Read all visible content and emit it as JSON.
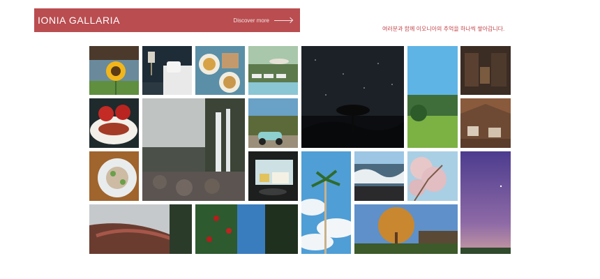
{
  "header": {
    "brand": "IONIA GALLARIA",
    "discover_label": "Discover more"
  },
  "tagline": "여러분과 함께 이오니아의 추억을 하나씩 쌓아갑니다.",
  "gallery": {
    "photos": [
      {
        "subject": "sunflower-photo"
      },
      {
        "subject": "hotel-bedroom-photo"
      },
      {
        "subject": "breakfast-table-photo"
      },
      {
        "subject": "poolside-loungers-photo"
      },
      {
        "subject": "night-sky-tree-photo"
      },
      {
        "subject": "green-field-sky-photo"
      },
      {
        "subject": "library-cafe-photo"
      },
      {
        "subject": "tomato-dish-photo"
      },
      {
        "subject": "waterfall-rocks-photo"
      },
      {
        "subject": "scooter-wall-photo"
      },
      {
        "subject": "restaurant-interior-photo"
      },
      {
        "subject": "salad-plate-photo"
      },
      {
        "subject": "window-view-photo"
      },
      {
        "subject": "palm-tree-photo"
      },
      {
        "subject": "ocean-waves-photo"
      },
      {
        "subject": "cherry-blossom-photo"
      },
      {
        "subject": "milky-way-photo"
      },
      {
        "subject": "wooden-bridge-photo"
      },
      {
        "subject": "red-camellia-tree-photo"
      },
      {
        "subject": "autumn-tree-house-photo"
      }
    ]
  }
}
